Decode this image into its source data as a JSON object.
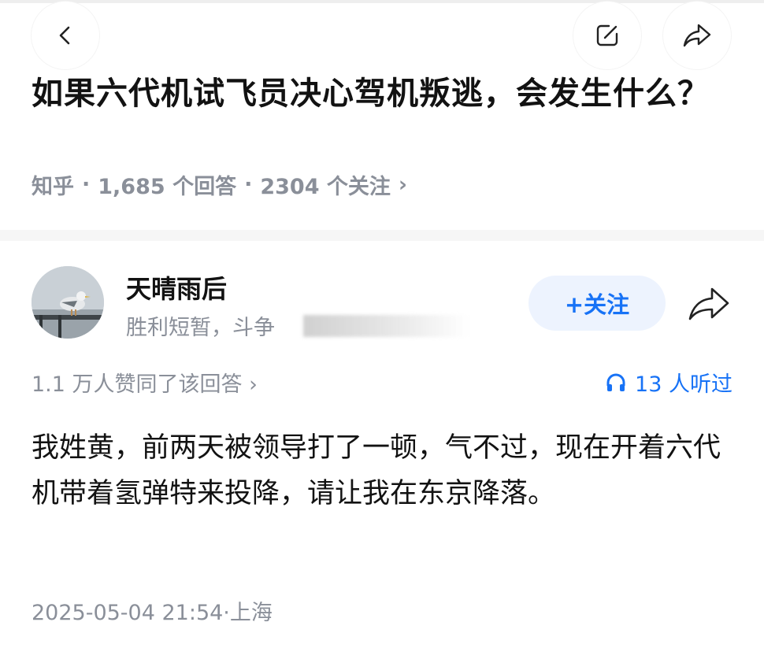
{
  "question": {
    "title": "如果六代机试飞员决心驾机叛逃，会发生什么？",
    "source": "知乎",
    "answers_count": "1,685 个回答",
    "followers_count": "2304 个关注",
    "chevron": "›"
  },
  "author": {
    "name": "天晴雨后",
    "bio": "胜利短暂，斗争",
    "follow_label": "+关注"
  },
  "stats": {
    "votes_text": "1.1 万人赞同了该回答 ›",
    "listens_text": "13 人听过"
  },
  "answer": {
    "text": "我姓黄，前两天被领导打了一顿，气不过，现在开着六代机带着氢弹特来投降，请让我在东京降落。",
    "timestamp": "2025-05-04 21:54·上海"
  },
  "icons": {
    "back": "chevron-left-icon",
    "edit": "edit-icon",
    "share": "share-icon",
    "headphones": "headphones-icon"
  },
  "colors": {
    "accent": "#1772f6",
    "meta_gray": "#8a8f99",
    "follow_bg": "#edf3fe"
  }
}
